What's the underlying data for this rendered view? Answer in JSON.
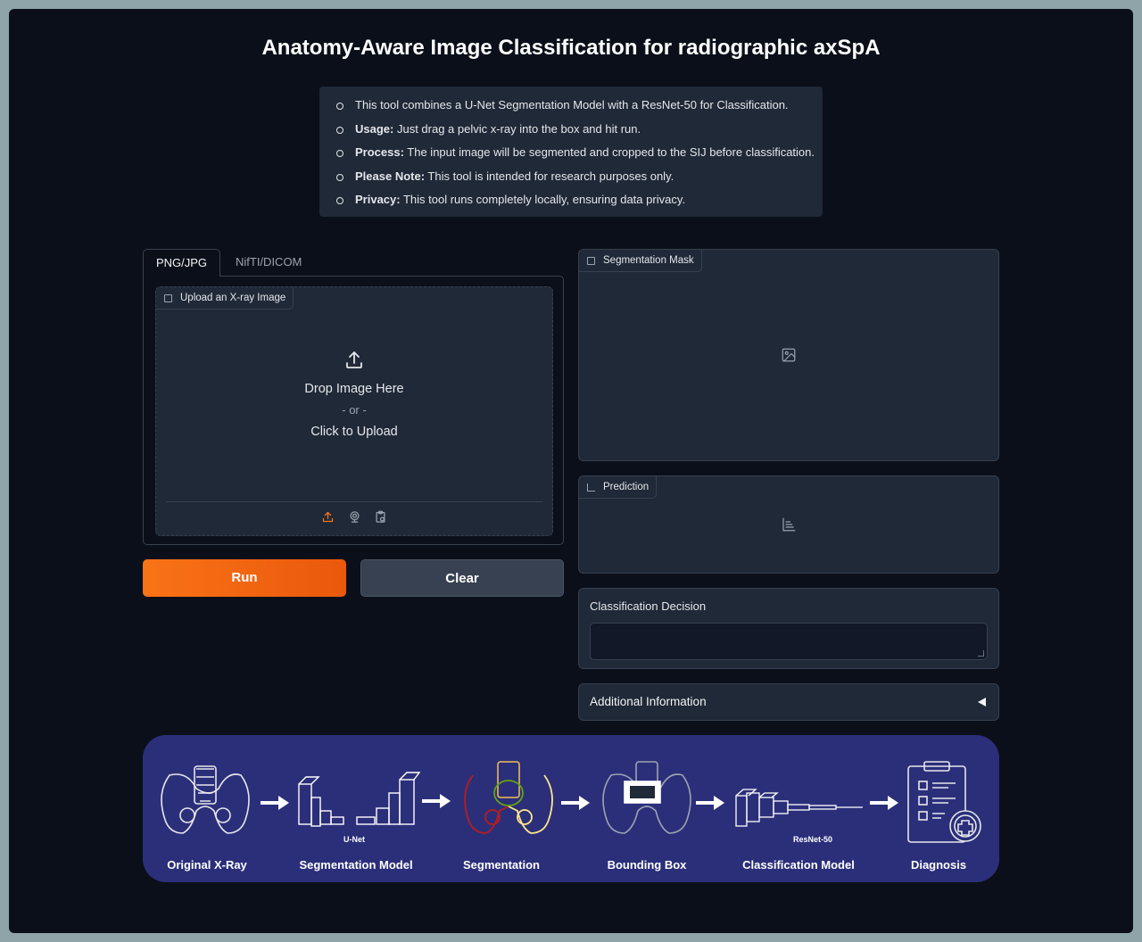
{
  "header": {
    "title": "Anatomy-Aware Image Classification for radiographic axSpA"
  },
  "info": {
    "items": [
      {
        "bold": "",
        "text": "This tool combines a U-Net Segmentation Model with a ResNet-50 for Classification."
      },
      {
        "bold": "Usage:",
        "text": " Just drag a pelvic x-ray into the box and hit run."
      },
      {
        "bold": "Process:",
        "text": " The input image will be segmented and cropped to the SIJ before classification."
      },
      {
        "bold": "Please Note:",
        "text": " This tool is intended for research purposes only."
      },
      {
        "bold": "Privacy:",
        "text": " This tool runs completely locally, ensuring data privacy."
      }
    ]
  },
  "input": {
    "tabs": [
      "PNG/JPG",
      "NifTI/DICOM"
    ],
    "active_tab": "PNG/JPG",
    "upload_label": "Upload an X-ray Image",
    "drop_text": "Drop Image Here",
    "or_text": "- or -",
    "click_text": "Click to Upload",
    "source_icons": [
      "upload-icon",
      "webcam-icon",
      "clipboard-icon"
    ]
  },
  "buttons": {
    "run": "Run",
    "clear": "Clear"
  },
  "outputs": {
    "segmentation_label": "Segmentation Mask",
    "prediction_label": "Prediction",
    "classification_label": "Classification Decision",
    "classification_value": "",
    "additional_label": "Additional Information"
  },
  "pipeline": {
    "stages": [
      "Original X-Ray",
      "Segmentation Model",
      "Segmentation",
      "Bounding Box",
      "Classification Model",
      "Diagnosis"
    ],
    "unet_label": "U-Net",
    "resnet_label": "ResNet-50"
  },
  "colors": {
    "accent": "#f97316",
    "background": "#0b0f19",
    "panel": "#1f2937",
    "pipeline_bg": "#2b2f7a"
  }
}
